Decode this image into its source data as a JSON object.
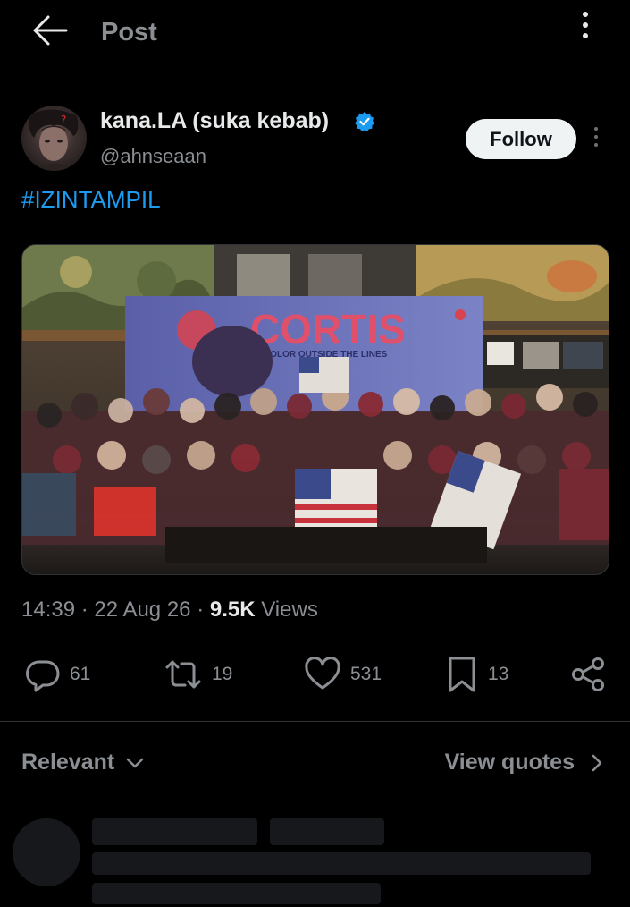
{
  "header": {
    "title": "Post",
    "back_icon": "arrow-left-icon",
    "more_icon": "more-vertical-icon"
  },
  "post": {
    "author": {
      "display_name": "kana.LA (suka kebab)",
      "handle": "@ahnseaan",
      "verified": true,
      "follow_label": "Follow"
    },
    "text": "#IZINTAMPIL",
    "media": {
      "banner_title": "CORTIS",
      "banner_subtitle": "COLOR OUTSIDE THE LINES"
    },
    "time": "14:39",
    "date": "22 Aug 26",
    "views_count": "9.5K",
    "views_label": "Views",
    "separator": "·"
  },
  "actions": {
    "replies": "61",
    "reposts": "19",
    "likes": "531",
    "bookmarks": "13"
  },
  "replies_bar": {
    "sort_label": "Relevant",
    "view_quotes_label": "View quotes"
  },
  "colors": {
    "background": "#000000",
    "accent": "#1d9bf0",
    "muted_text": "#8b8f93",
    "primary_text": "#e7e9ea",
    "follow_bg": "#eff3f4"
  }
}
